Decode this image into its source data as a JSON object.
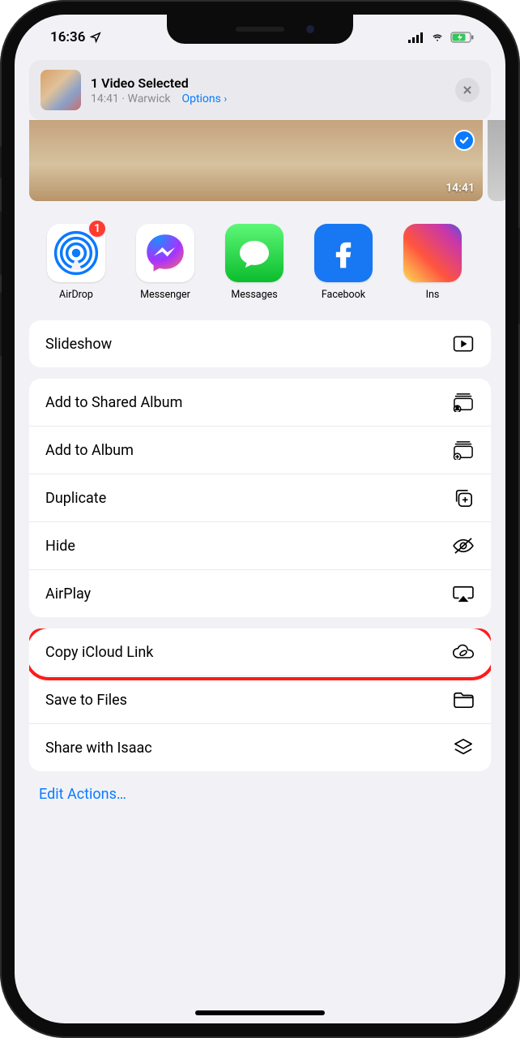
{
  "status": {
    "time": "16:36",
    "location_icon": "location"
  },
  "header": {
    "title": "1 Video Selected",
    "time": "14:41",
    "location": "Warwick",
    "options_label": "Options"
  },
  "preview": {
    "duration": "14:41"
  },
  "apps": [
    {
      "name": "AirDrop",
      "badge": "1"
    },
    {
      "name": "Messenger"
    },
    {
      "name": "Messages"
    },
    {
      "name": "Facebook"
    },
    {
      "name": "Ins"
    }
  ],
  "actions": {
    "slideshow": "Slideshow",
    "add_shared": "Add to Shared Album",
    "add_album": "Add to Album",
    "duplicate": "Duplicate",
    "hide": "Hide",
    "airplay": "AirPlay",
    "copy_icloud": "Copy iCloud Link",
    "save_files": "Save to Files",
    "share_with": "Share with Isaac"
  },
  "footer": {
    "edit_actions": "Edit Actions…"
  }
}
